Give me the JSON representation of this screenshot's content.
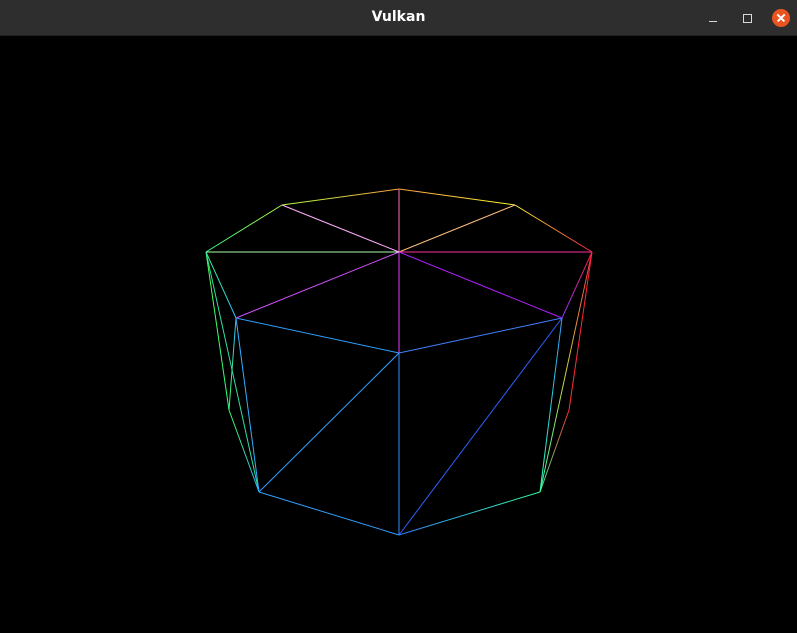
{
  "window": {
    "title": "Vulkan"
  },
  "controls": {
    "minimize_icon": "minimize-icon",
    "maximize_icon": "maximize-icon",
    "close_icon": "close-icon"
  },
  "colors": {
    "titlebar": "#2e2e2e",
    "title_text": "#ffffff",
    "close_button": "#e95420",
    "viewport_background": "#000000"
  }
}
